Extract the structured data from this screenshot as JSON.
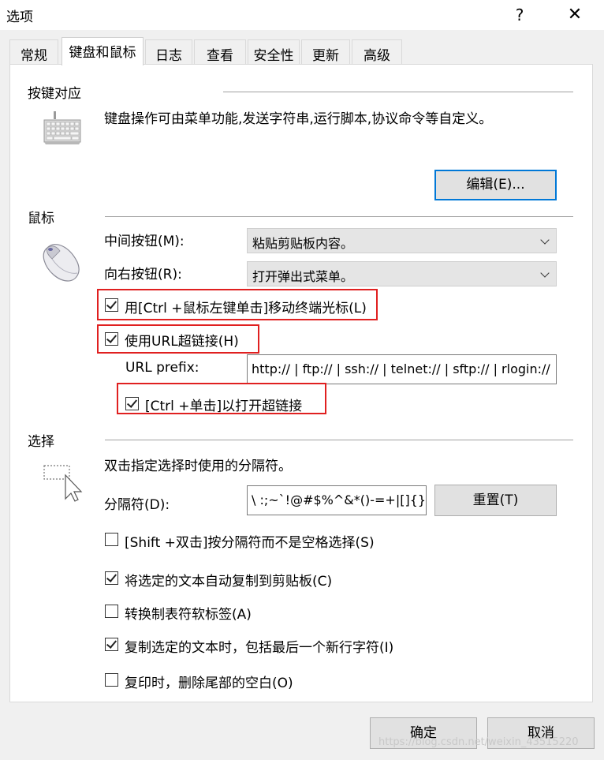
{
  "window": {
    "title": "选项",
    "help_glyph": "?",
    "close_glyph": "✕"
  },
  "tabs": [
    {
      "label": "常规"
    },
    {
      "label": "键盘和鼠标",
      "active": true
    },
    {
      "label": "日志"
    },
    {
      "label": "查看"
    },
    {
      "label": "安全性"
    },
    {
      "label": "更新"
    },
    {
      "label": "高级"
    }
  ],
  "keymap": {
    "title": "按键对应",
    "description": "键盘操作可由菜单功能,发送字符串,运行脚本,协议命令等自定义。",
    "edit_button": "编辑(E)...",
    "icon": "keyboard-icon"
  },
  "mouse": {
    "title": "鼠标",
    "icon": "mouse-icon",
    "middle_label": "中间按钮(M):",
    "middle_value": "粘贴剪贴板内容。",
    "right_label": "向右按钮(R):",
    "right_value": "打开弹出式菜单。",
    "ctrl_move_label": "用[Ctrl +鼠标左键单击]移动终端光标(L)",
    "ctrl_move_checked": true,
    "url_label": "使用URL超链接(H)",
    "url_checked": true,
    "url_prefix_label": "URL prefix:",
    "url_prefix_value": "http:// | ftp:// | ssh:// | telnet:// | sftp:// | rlogin://",
    "ctrl_click_label": "[Ctrl +单击]以打开超链接",
    "ctrl_click_checked": true
  },
  "selection": {
    "title": "选择",
    "icon": "selection-cursor-icon",
    "description": "双击指定选择时使用的分隔符。",
    "delim_label": "分隔符(D):",
    "delim_value": "\\ :;~`!@#$%^&*()-=+|[]{}\"'",
    "reset_button": "重置(T)",
    "options": [
      {
        "label": "[Shift +双击]按分隔符而不是空格选择(S)",
        "checked": false
      },
      {
        "label": "将选定的文本自动复制到剪贴板(C)",
        "checked": true
      },
      {
        "label": "转换制表符软标签(A)",
        "checked": false
      },
      {
        "label": "复制选定的文本时，包括最后一个新行字符(I)",
        "checked": true
      },
      {
        "label": "复印时，删除尾部的空白(O)",
        "checked": false
      }
    ]
  },
  "footer": {
    "ok": "确定",
    "cancel": "取消"
  },
  "watermark": "https://blog.csdn.net/weixin_43515220",
  "colors": {
    "highlight_red": "#e02020",
    "focus_blue": "#0078d7"
  }
}
